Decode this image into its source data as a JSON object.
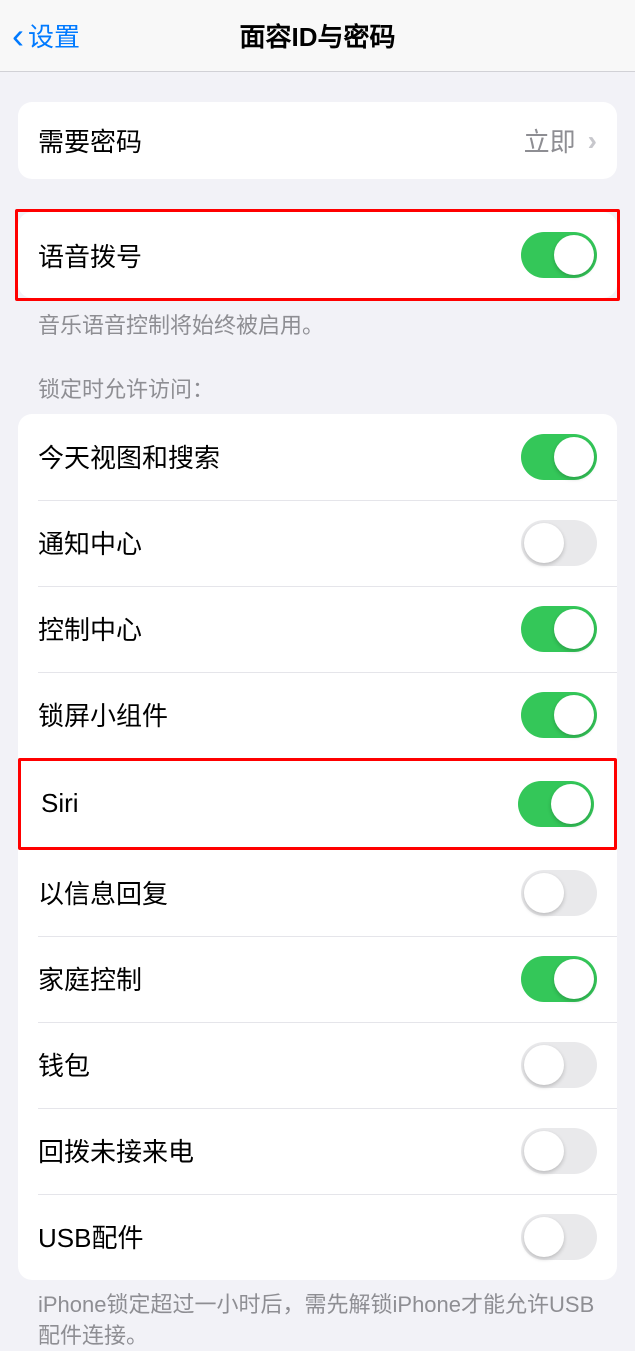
{
  "header": {
    "back_label": "设置",
    "title": "面容ID与密码"
  },
  "passcode_group": {
    "require_passcode_label": "需要密码",
    "require_passcode_value": "立即"
  },
  "voice_dial": {
    "label": "语音拨号",
    "on": true,
    "footer": "音乐语音控制将始终被启用。"
  },
  "lock_section": {
    "header": "锁定时允许访问：",
    "items": [
      {
        "label": "今天视图和搜索",
        "on": true
      },
      {
        "label": "通知中心",
        "on": false
      },
      {
        "label": "控制中心",
        "on": true
      },
      {
        "label": "锁屏小组件",
        "on": true
      },
      {
        "label": "Siri",
        "on": true
      },
      {
        "label": "以信息回复",
        "on": false
      },
      {
        "label": "家庭控制",
        "on": true
      },
      {
        "label": "钱包",
        "on": false
      },
      {
        "label": "回拨未接来电",
        "on": false
      },
      {
        "label": "USB配件",
        "on": false
      }
    ],
    "footer": "iPhone锁定超过一小时后，需先解锁iPhone才能允许USB配件连接。"
  }
}
